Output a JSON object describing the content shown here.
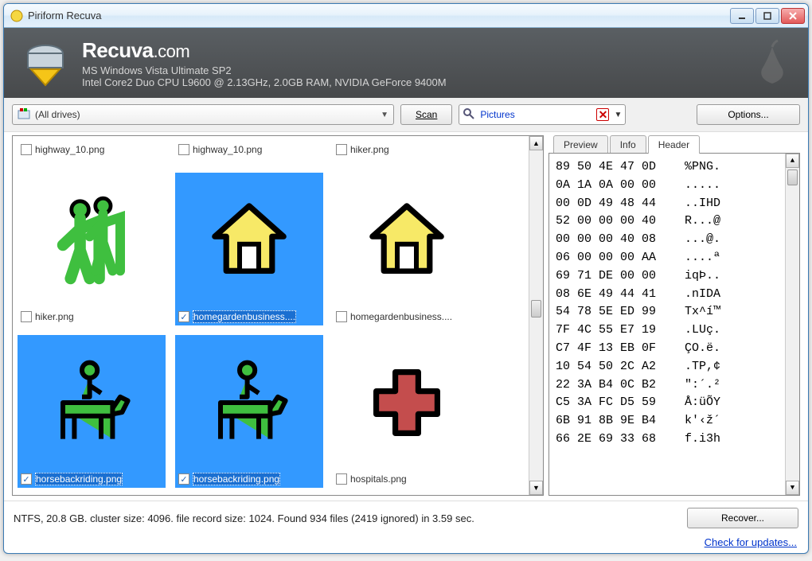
{
  "window": {
    "title": "Piriform Recuva"
  },
  "banner": {
    "brand": "Recuva",
    "brand_suffix": ".com",
    "sys1": "MS Windows Vista Ultimate SP2",
    "sys2": "Intel Core2 Duo CPU L9600 @ 2.13GHz, 2.0GB RAM, NVIDIA GeForce 9400M"
  },
  "toolbar": {
    "drive": "(All drives)",
    "scan_label": "Scan",
    "filter": "Pictures",
    "options_label": "Options..."
  },
  "files": [
    {
      "name": "highway_10.png",
      "checked": false,
      "selected": false,
      "partial": true
    },
    {
      "name": "highway_10.png",
      "checked": false,
      "selected": false,
      "partial": true
    },
    {
      "name": "hiker.png",
      "checked": false,
      "selected": false,
      "partial": true
    },
    {
      "name": "hiker.png",
      "checked": false,
      "selected": false
    },
    {
      "name": "homegardenbusiness....",
      "checked": true,
      "selected": true
    },
    {
      "name": "homegardenbusiness....",
      "checked": false,
      "selected": false
    },
    {
      "name": "horsebackriding.png",
      "checked": true,
      "selected": true
    },
    {
      "name": "horsebackriding.png",
      "checked": true,
      "selected": true
    },
    {
      "name": "hospitals.png",
      "checked": false,
      "selected": false
    }
  ],
  "tabs": {
    "preview": "Preview",
    "info": "Info",
    "header": "Header",
    "active": "header"
  },
  "hex_lines": [
    "89 50 4E 47 0D    %PNG.",
    "0A 1A 0A 00 00    .....",
    "00 0D 49 48 44    ..IHD",
    "52 00 00 00 40    R...@",
    "00 00 00 40 08    ...@.",
    "06 00 00 00 AA    ....ª",
    "69 71 DE 00 00    iqÞ..",
    "08 6E 49 44 41    .nIDA",
    "54 78 5E ED 99    Tx^í™",
    "7F 4C 55 E7 19    .LUç.",
    "C7 4F 13 EB 0F    ÇO.ë.",
    "10 54 50 2C A2    .TP,¢",
    "22 3A B4 0C B2    \":´.²",
    "C5 3A FC D5 59    Å:üÕY",
    "6B 91 8B 9E B4    k'‹ž´",
    "66 2E 69 33 68    f.i3h"
  ],
  "status": {
    "text": "NTFS, 20.8 GB. cluster size: 4096. file record size: 1024. Found 934 files (2419 ignored) in 3.59 sec.",
    "recover_label": "Recover..."
  },
  "footer": {
    "update_link": "Check for updates..."
  }
}
